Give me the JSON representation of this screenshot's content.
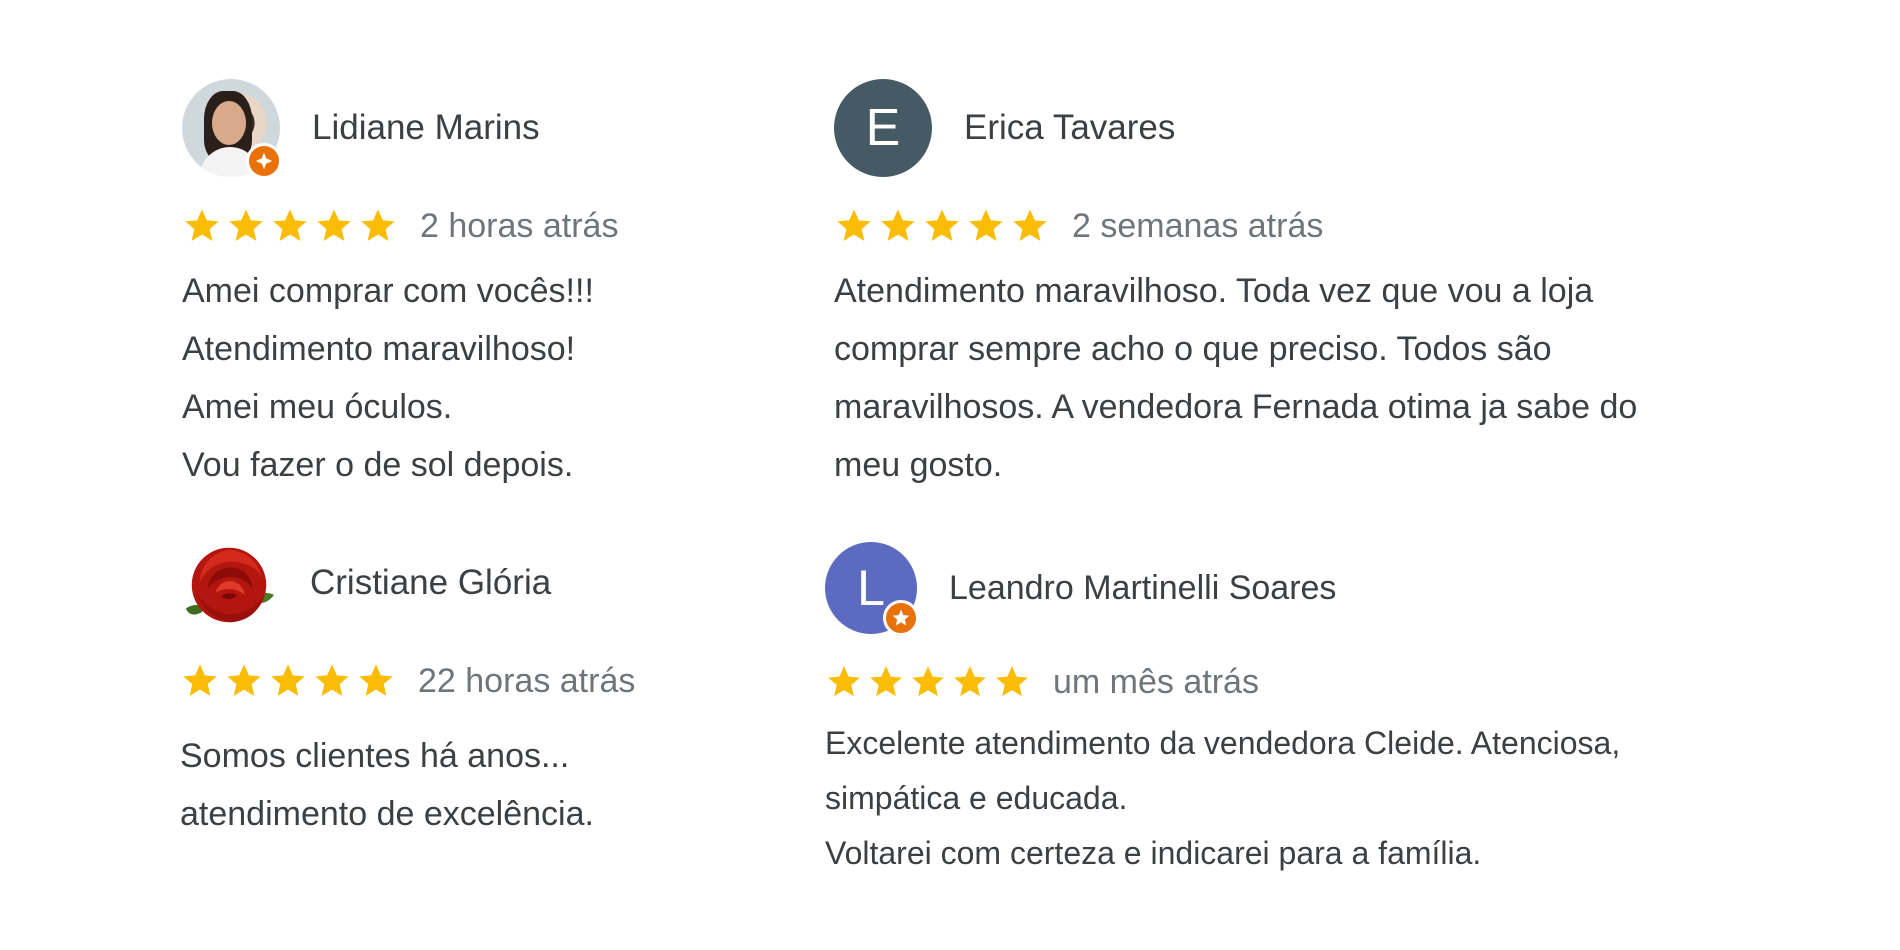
{
  "colors": {
    "star": "#fbbc04",
    "badge": "#e8710a",
    "avatar_erica": "#455a64",
    "avatar_leandro": "#5c6bc0",
    "text": "#3c4043",
    "muted": "#70757a"
  },
  "reviews": [
    {
      "author": "Lidiane Marins",
      "avatar": {
        "type": "photo",
        "icon": "profile-photo-icon",
        "local_guide_badge": true
      },
      "rating": 5,
      "time": "2 horas atrás",
      "lines": [
        "Amei comprar com vocês!!!",
        "Atendimento maravilhoso!",
        "Amei meu óculos.",
        "Vou fazer o de sol depois."
      ]
    },
    {
      "author": "Erica Tavares",
      "avatar": {
        "type": "letter",
        "letter": "E",
        "local_guide_badge": false
      },
      "rating": 5,
      "time": "2 semanas atrás",
      "lines": [
        "Atendimento maravilhoso. Toda vez que vou a loja",
        "comprar sempre acho o que preciso. Todos são",
        "maravilhosos. A vendedora Fernada otima ja sabe do",
        "meu gosto."
      ]
    },
    {
      "author": "Cristiane Glória",
      "avatar": {
        "type": "image",
        "icon": "rose-icon",
        "local_guide_badge": false
      },
      "rating": 5,
      "time": "22 horas atrás",
      "lines": [
        "Somos clientes há anos...",
        "atendimento de excelência."
      ]
    },
    {
      "author": "Leandro Martinelli Soares",
      "avatar": {
        "type": "letter",
        "letter": "L",
        "local_guide_badge": true
      },
      "rating": 5,
      "time": "um mês atrás",
      "lines": [
        "Excelente atendimento da vendedora Cleide. Atenciosa,",
        "simpática e educada.",
        "Voltarei com certeza e indicarei para a família."
      ]
    }
  ]
}
